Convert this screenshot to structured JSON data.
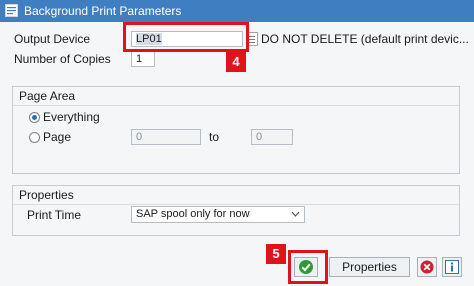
{
  "window": {
    "title": "Background Print Parameters"
  },
  "output_device": {
    "label": "Output Device",
    "value": "LP01",
    "description": "DO NOT DELETE (default print devic..."
  },
  "copies": {
    "label": "Number of Copies",
    "value": "1"
  },
  "page_area": {
    "title": "Page Area",
    "everything_label": "Everything",
    "page_label": "Page",
    "from_value": "0",
    "to_label": "to",
    "to_value": "0",
    "selected": "everything"
  },
  "properties": {
    "title": "Properties",
    "print_time_label": "Print Time",
    "print_time_value": "SAP spool only for now"
  },
  "buttons": {
    "properties_label": "Properties"
  },
  "annotations": {
    "step4": "4",
    "step5": "5"
  },
  "colors": {
    "title_bar": "#3f7fc1",
    "annotation": "#e0121b",
    "check": "#2e9a3b",
    "cancel": "#d0202a",
    "info": "#2e6fb5"
  }
}
